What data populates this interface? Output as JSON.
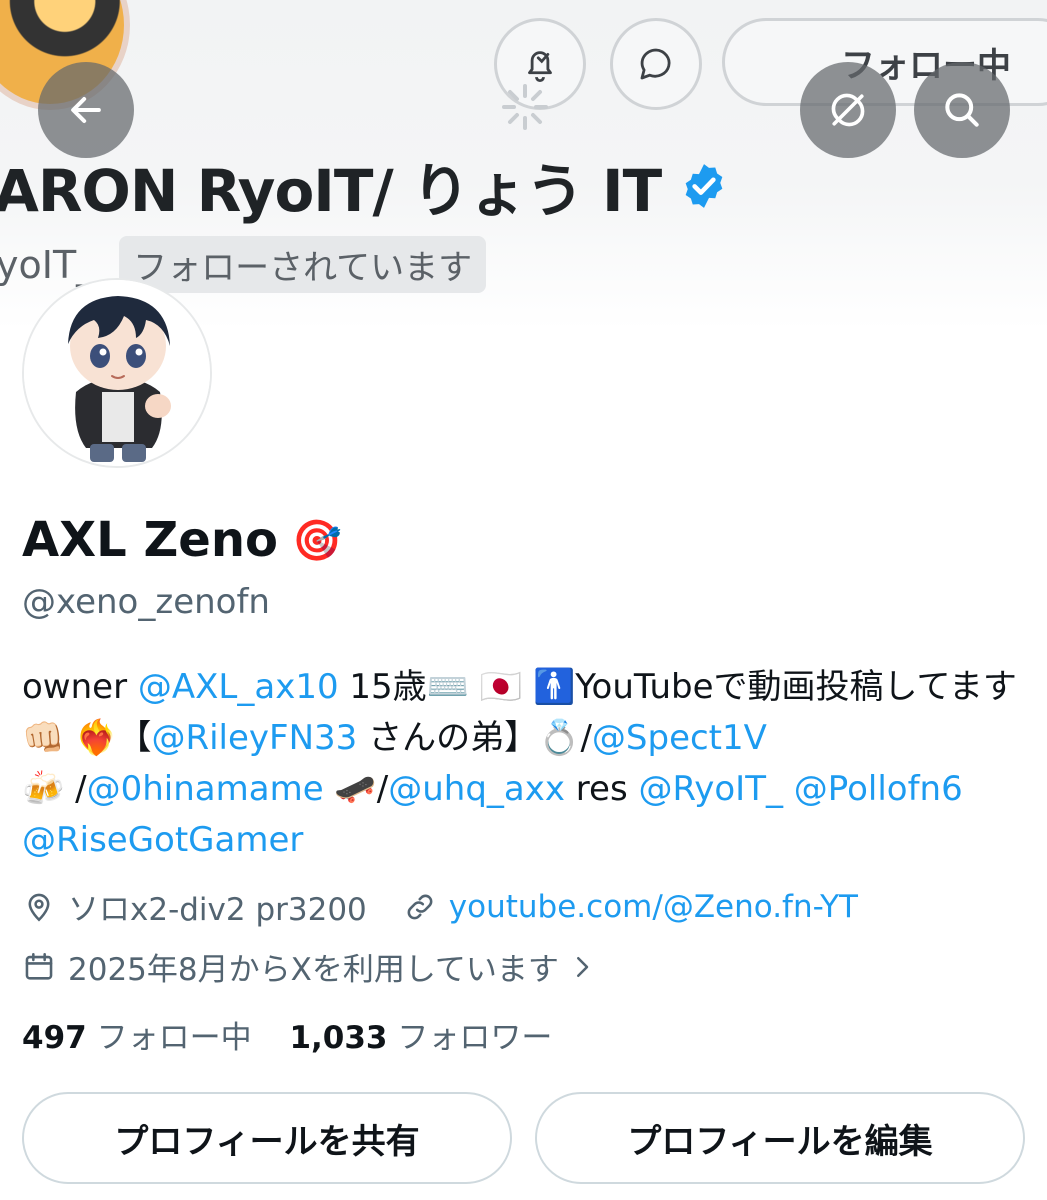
{
  "header": {
    "bg_name": "ARON RyoIT/ りょう IT",
    "bg_handle": "yoIT_",
    "follows_you": "フォローされています",
    "following_button": "フォロー中",
    "icons": {
      "back": "arrow-left-icon",
      "grok": "grok-icon",
      "search": "search-icon",
      "notify": "bell-check-icon",
      "message": "message-icon",
      "verified": "verified-badge-icon"
    },
    "colors": {
      "verified": "#1d9bf0"
    }
  },
  "profile": {
    "name": "AXL Zeno",
    "name_emoji": "🎯",
    "handle": "@xeno_zenofn",
    "bio": {
      "t1": "owner ",
      "m1": "@AXL_ax10",
      "t2": " 15歳⌨️ 🇯🇵 🚹YouTubeで動画投稿してます👊🏻 ❤️‍🔥【",
      "m2": "@RileyFN33",
      "t3": " さんの弟】💍/",
      "m3": "@Spect1V",
      "t4": " 🍻 /",
      "m4": "@0hinamame",
      "t5": " 🛹/",
      "m5": "@uhq_axx",
      "t6": " res ",
      "m6": "@RyoIT_",
      "t7": " ",
      "m7": "@Pollofn6",
      "t8": " ",
      "m8": "@RiseGotGamer"
    },
    "location": "ソロx2-div2 pr3200",
    "website": "youtube.com/@Zeno.fn-YT",
    "joined": "2025年8月からXを利用しています",
    "following_count": "497",
    "following_label": "フォロー中",
    "followers_count": "1,033",
    "followers_label": "フォロワー",
    "share_button": "プロフィールを共有",
    "edit_button": "プロフィールを編集",
    "colors": {
      "link": "#1d9bf0",
      "muted": "#536471"
    }
  }
}
